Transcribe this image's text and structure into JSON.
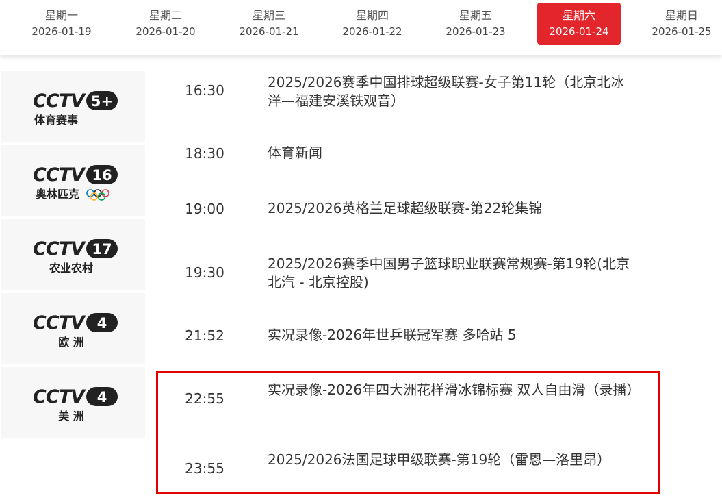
{
  "days": [
    {
      "weekday": "星期一",
      "date": "2026-01-19"
    },
    {
      "weekday": "星期二",
      "date": "2026-01-20"
    },
    {
      "weekday": "星期三",
      "date": "2026-01-21"
    },
    {
      "weekday": "星期四",
      "date": "2026-01-22"
    },
    {
      "weekday": "星期五",
      "date": "2026-01-23"
    },
    {
      "weekday": "星期六",
      "date": "2026-01-24"
    },
    {
      "weekday": "星期日",
      "date": "2026-01-25"
    }
  ],
  "active_day": "2026-01-24",
  "channels": [
    {
      "brand": "CCTV",
      "number": "5+",
      "name": "体育赛事"
    },
    {
      "brand": "CCTV",
      "number": "16",
      "name": "奥林匹克"
    },
    {
      "brand": "CCTV",
      "number": "17",
      "name": "农业农村"
    },
    {
      "brand": "CCTV",
      "number": "4",
      "name": "欧 洲"
    },
    {
      "brand": "CCTV",
      "number": "4",
      "name": "美 洲"
    }
  ],
  "programs": [
    {
      "time": "16:30",
      "title": "2025/2026赛季中国排球超级联赛-女子第11轮（北京北冰洋—福建安溪铁观音）"
    },
    {
      "time": "18:30",
      "title": "体育新闻"
    },
    {
      "time": "19:00",
      "title": "2025/2026英格兰足球超级联赛-第22轮集锦"
    },
    {
      "time": "19:30",
      "title": "2025/2026赛季中国男子篮球职业联赛常规赛-第19轮(北京北汽 - 北京控股)"
    },
    {
      "time": "21:52",
      "title": "实况录像-2026年世乒联冠军赛 多哈站 5"
    },
    {
      "time": "22:55",
      "title": "实况录像-2026年四大洲花样滑冰锦标赛 双人自由滑（录播）"
    },
    {
      "time": "23:55",
      "title": "2025/2026法国足球甲级联赛-第19轮（雷恩—洛里昂）"
    }
  ],
  "colors": {
    "accent": "#e2262c",
    "highlight": "#e00000",
    "text": "#333333"
  }
}
